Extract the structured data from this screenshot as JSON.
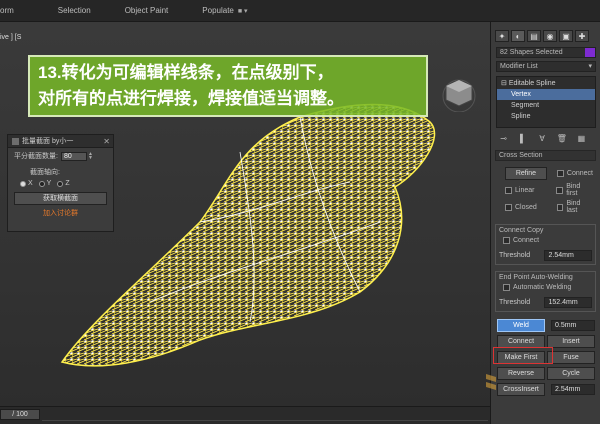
{
  "menubar": {
    "items": [
      "orm",
      "Selection",
      "Object Paint",
      "Populate"
    ]
  },
  "viewport": {
    "label": "ive ] [S",
    "banner_line1": "13.转化为可编辑样线条，在点级别下，",
    "banner_line2": "对所有的点进行焊接，焊接值适当调整。"
  },
  "dialog": {
    "title": "批量截面 by小一",
    "count_label": "平分截面数量:",
    "count_value": "80",
    "axis_label": "截面轴向:",
    "axes": [
      "X",
      "Y",
      "Z"
    ],
    "get_button": "获取横截面",
    "join_link": "加入讨论群"
  },
  "timebar": {
    "slider": "/ 100"
  },
  "command_panel": {
    "selection_field": "82 Shapes Selected",
    "modifier_list": "Modifier List",
    "stack": [
      "Editable Spline",
      "Vertex",
      "Segment",
      "Spline"
    ],
    "cross_section": {
      "title": "Cross Section",
      "refine": "Refine",
      "connect": "Connect",
      "linear": "Linear",
      "bind_first": "Bind first",
      "closed": "Closed",
      "bind_last": "Bind last"
    },
    "connect_copy": {
      "title": "Connect Copy",
      "connect": "Connect",
      "threshold_label": "Threshold",
      "threshold_value": "2.54mm"
    },
    "auto_weld": {
      "title": "End Point Auto-Welding",
      "auto": "Automatic Welding",
      "threshold_label": "Threshold",
      "threshold_value": "152.4mm"
    },
    "weld": "Weld",
    "weld_value": "0.5mm",
    "connect": "Connect",
    "insert": "Insert",
    "make_first": "Make First",
    "fuse": "Fuse",
    "reverse": "Reverse",
    "cycle": "Cycle",
    "crossinsert": "CrossInsert",
    "crossinsert_value": "2.54mm"
  },
  "colors": {
    "wire": "#ffe84a",
    "banner": "#78ba28",
    "selection": "#4b6d9d",
    "weld": "#4b88d4"
  }
}
